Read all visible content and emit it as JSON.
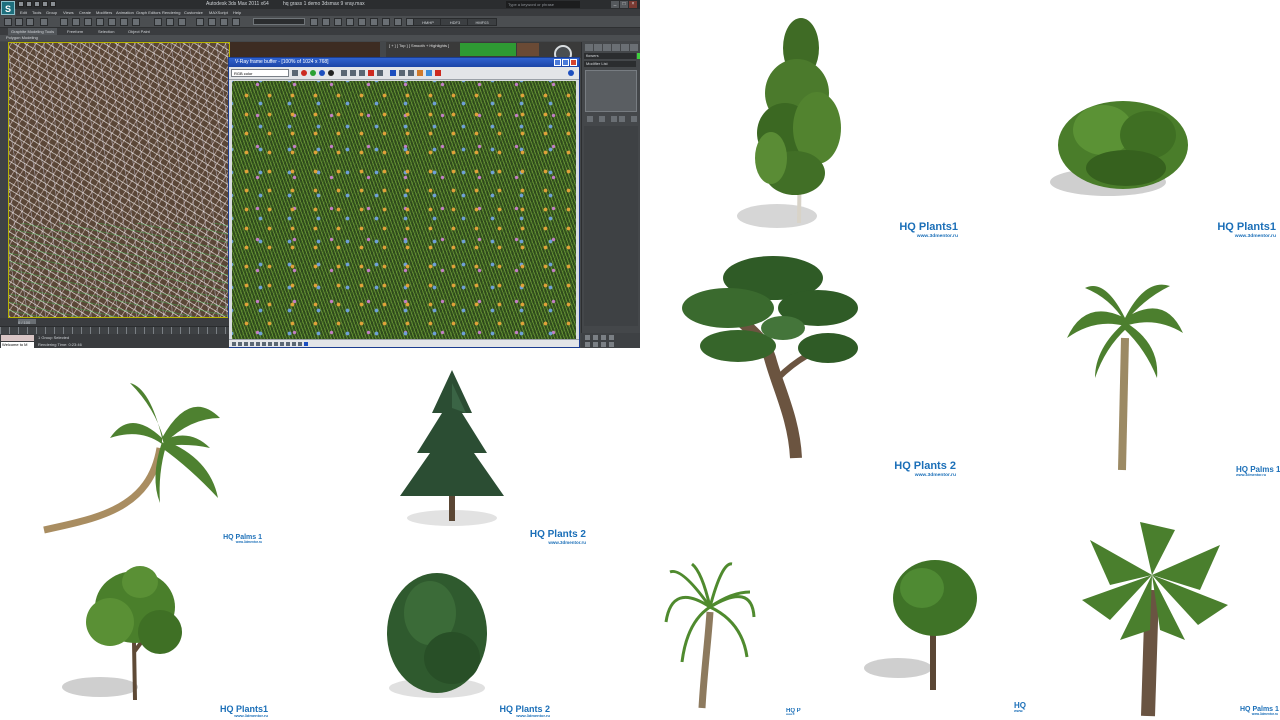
{
  "app": {
    "title": "Autodesk 3ds Max  2011 x64",
    "file_name": "hq grass 1 demo 3dsmax 9 vray.max",
    "search_placeholder": "Type a keyword or phrase",
    "logo_letter": "S",
    "menus": [
      "Edit",
      "Tools",
      "Group",
      "Views",
      "Create",
      "Modifiers",
      "Animation",
      "Graph Editors",
      "Rendering",
      "Customize",
      "MAXScript",
      "Help"
    ],
    "toolbar_labels": [
      "HMHP",
      "HDF3",
      "HMF03"
    ],
    "ribbon_tabs": [
      "Graphite Modeling Tools",
      "Freeform",
      "Selection",
      "Object Paint"
    ],
    "ribbon_panel": "Polygon Modeling",
    "viewport_label": "[ + ] [ Top ] [ Smooth + Highlights ]",
    "timeline_text": "0 / 100",
    "maxscript_text": "Welcome to M",
    "status_selection": "1 Group Selected",
    "status_render": "Rendering Time: 0:23:46"
  },
  "vray": {
    "title": "V-Ray frame buffer - [100% of 1024 x 768]",
    "channel": "RGB color",
    "colors": {
      "title_bar": "#2f62d0",
      "red": "#cc2a1f",
      "green": "#2aa033",
      "blue": "#1d4fbf"
    }
  },
  "command_panel": {
    "object_name": "flowers",
    "modifier_list": "Modifier List"
  },
  "catalog": {
    "accent_color": "#1b6fb8",
    "captions": [
      {
        "title": "HQ Plants1",
        "url": "www.3dmentor.ru"
      },
      {
        "title": "HQ Plants1",
        "url": "www.3dmentor.ru"
      },
      {
        "title": "HQ Plants 2",
        "url": "www.3dmentor.ru"
      },
      {
        "title": "HQ Palms 1",
        "url": "www.3dmentor.ru"
      },
      {
        "title": "HQ Palms 1",
        "url": "www.3dmentor.ru"
      },
      {
        "title": "HQ Plants 2",
        "url": "www.3dmentor.ru"
      },
      {
        "title": "HQ Plants1",
        "url": "www.3dmentor.ru"
      },
      {
        "title": "HQ Plants 2",
        "url": "www.3dmentor.ru"
      },
      {
        "title": "HQ P",
        "url": "www.3"
      },
      {
        "title": "HQ",
        "url": "www."
      },
      {
        "title": "HQ Palms 1",
        "url": "www.3dmentor.ru"
      }
    ],
    "plants": [
      "birch-tree",
      "round-shrub",
      "bonsai-pine",
      "palm-tree",
      "bent-palm",
      "spruce-tree",
      "deciduous-tree",
      "small-pine",
      "dracaena",
      "topiary-tree",
      "fan-palm"
    ]
  }
}
